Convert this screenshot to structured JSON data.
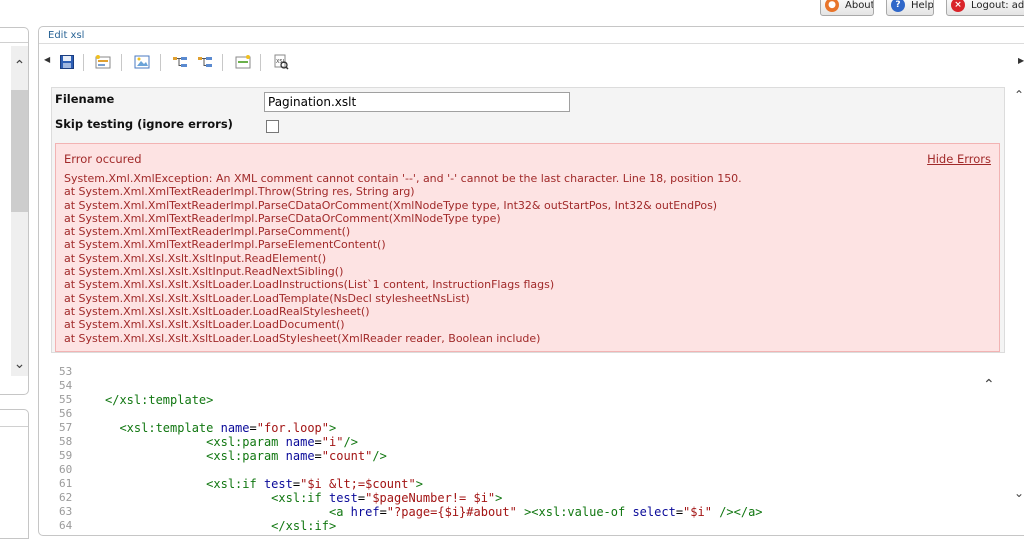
{
  "header": {
    "about_label": "About",
    "help_label": "Help",
    "logout_label": "Logout: admi"
  },
  "panel": {
    "title": "Edit xsl"
  },
  "form": {
    "filename_label": "Filename",
    "filename_value": "Pagination.xslt",
    "skip_label": "Skip testing (ignore errors)",
    "skip_checked": false
  },
  "error": {
    "title": "Error occured",
    "hide_label": "Hide Errors",
    "lines": [
      "System.Xml.XmlException: An XML comment cannot contain '--', and '-' cannot be the last character. Line 18, position 150.",
      "at System.Xml.XmlTextReaderImpl.Throw(String res, String arg)",
      "at System.Xml.XmlTextReaderImpl.ParseCDataOrComment(XmlNodeType type, Int32& outStartPos, Int32& outEndPos)",
      "at System.Xml.XmlTextReaderImpl.ParseCDataOrComment(XmlNodeType type)",
      "at System.Xml.XmlTextReaderImpl.ParseComment()",
      "at System.Xml.XmlTextReaderImpl.ParseElementContent()",
      "at System.Xml.Xsl.Xslt.XsltInput.ReadElement()",
      "at System.Xml.Xsl.Xslt.XsltInput.ReadNextSibling()",
      "at System.Xml.Xsl.Xslt.XsltLoader.LoadInstructions(List`1 content, InstructionFlags flags)",
      "at System.Xml.Xsl.Xslt.XsltLoader.LoadTemplate(NsDecl stylesheetNsList)",
      "at System.Xml.Xsl.Xslt.XsltLoader.LoadRealStylesheet()",
      "at System.Xml.Xsl.Xslt.XsltLoader.LoadDocument()",
      "at System.Xml.Xsl.Xslt.XsltLoader.LoadStylesheet(XmlReader reader, Boolean include)"
    ]
  },
  "code": {
    "lines": [
      {
        "num": "53",
        "indent": "",
        "parts": []
      },
      {
        "num": "54",
        "indent": "",
        "parts": []
      },
      {
        "num": "55",
        "indent": "",
        "parts": [
          [
            "tag",
            "</xsl:template>"
          ]
        ]
      },
      {
        "num": "56",
        "indent": "",
        "parts": []
      },
      {
        "num": "57",
        "indent": "  ",
        "parts": [
          [
            "tag",
            "<xsl:template "
          ],
          [
            "attr",
            "name"
          ],
          [
            "pl",
            "="
          ],
          [
            "str",
            "\"for.loop\""
          ],
          [
            "tag",
            ">"
          ]
        ]
      },
      {
        "num": "58",
        "indent": "              ",
        "parts": [
          [
            "tag",
            "<xsl:param "
          ],
          [
            "attr",
            "name"
          ],
          [
            "pl",
            "="
          ],
          [
            "str",
            "\"i\""
          ],
          [
            "tag",
            "/>"
          ]
        ]
      },
      {
        "num": "59",
        "indent": "              ",
        "parts": [
          [
            "tag",
            "<xsl:param "
          ],
          [
            "attr",
            "name"
          ],
          [
            "pl",
            "="
          ],
          [
            "str",
            "\"count\""
          ],
          [
            "tag",
            "/>"
          ]
        ]
      },
      {
        "num": "60",
        "indent": "",
        "parts": []
      },
      {
        "num": "61",
        "indent": "              ",
        "parts": [
          [
            "tag",
            "<xsl:if "
          ],
          [
            "attr",
            "test"
          ],
          [
            "pl",
            "="
          ],
          [
            "str",
            "\"$i &lt;=$count\""
          ],
          [
            "tag",
            ">"
          ]
        ]
      },
      {
        "num": "62",
        "indent": "                       ",
        "parts": [
          [
            "tag",
            "<xsl:if "
          ],
          [
            "attr",
            "test"
          ],
          [
            "pl",
            "="
          ],
          [
            "str",
            "\"$pageNumber!= $i\""
          ],
          [
            "tag",
            ">"
          ]
        ]
      },
      {
        "num": "63",
        "indent": "                               ",
        "parts": [
          [
            "tag",
            "<a "
          ],
          [
            "attr",
            "href"
          ],
          [
            "pl",
            "="
          ],
          [
            "str",
            "\"?page={$i}#about\""
          ],
          [
            "pl",
            " "
          ],
          [
            "tag",
            "><xsl:value-of "
          ],
          [
            "attr",
            "select"
          ],
          [
            "pl",
            "="
          ],
          [
            "str",
            "\"$i\""
          ],
          [
            "pl",
            " "
          ],
          [
            "tag",
            "/></a>"
          ]
        ]
      },
      {
        "num": "64",
        "indent": "                       ",
        "parts": [
          [
            "tag",
            "</xsl:if>"
          ]
        ]
      }
    ]
  },
  "colors": {
    "error_bg": "#fde3e3",
    "error_text": "#a12a2a",
    "title_link": "#2a6496"
  }
}
